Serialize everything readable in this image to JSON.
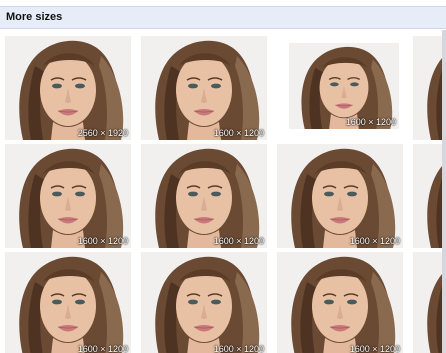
{
  "header": {
    "title": "More sizes"
  },
  "results": {
    "rows": [
      [
        {
          "dims": "2560 × 1920"
        },
        {
          "dims": "1600 × 1200"
        },
        {
          "dims": "1600 × 1200"
        },
        {
          "dims": ""
        }
      ],
      [
        {
          "dims": "1600 × 1200"
        },
        {
          "dims": "1600 × 1200"
        },
        {
          "dims": "1600 × 1200"
        },
        {
          "dims": ""
        }
      ],
      [
        {
          "dims": "1600 × 1200"
        },
        {
          "dims": "1600 × 1200"
        },
        {
          "dims": "1600 × 1200"
        },
        {
          "dims": ""
        }
      ]
    ]
  },
  "colors": {
    "header_bg": "#e7edf8",
    "label_text": "#ffffff"
  }
}
